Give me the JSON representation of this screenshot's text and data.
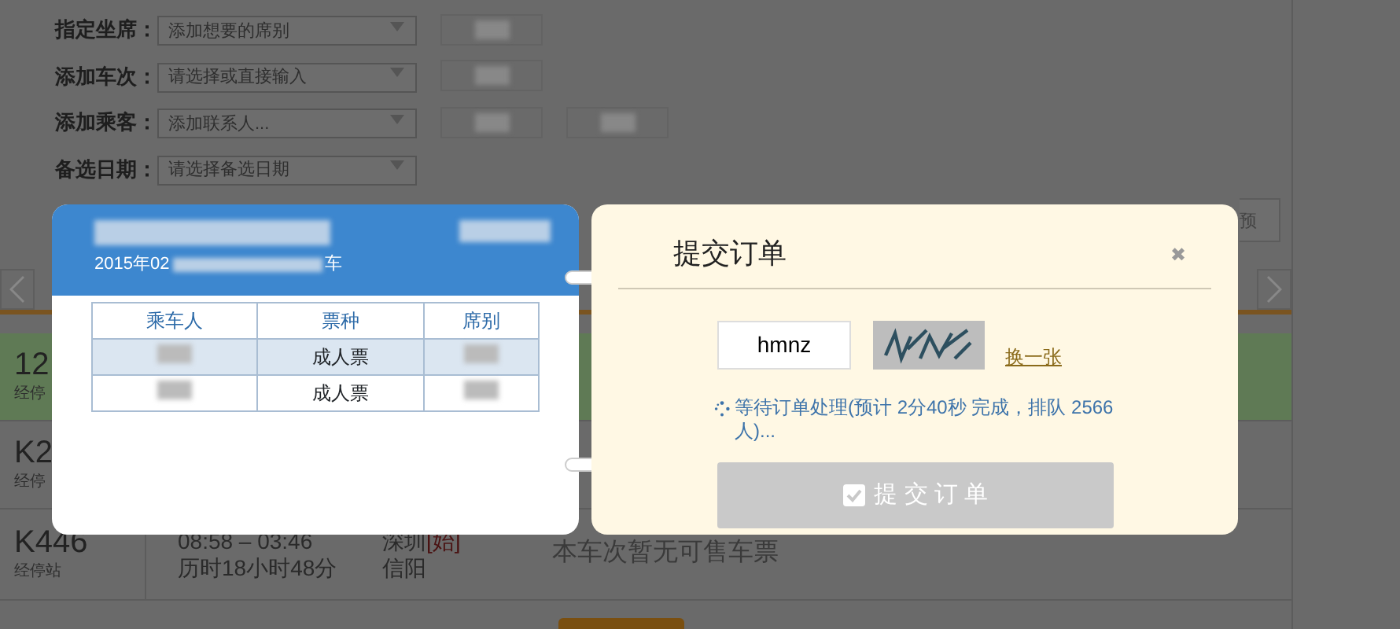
{
  "form": {
    "fields": [
      {
        "label": "指定坐席：",
        "placeholder": "添加想要的席别"
      },
      {
        "label": "添加车次：",
        "placeholder": "请选择或直接输入"
      },
      {
        "label": "添加乘客：",
        "placeholder": "添加联系人..."
      },
      {
        "label": "备选日期：",
        "placeholder": "请选择备选日期"
      }
    ]
  },
  "side_button": "预",
  "trains": [
    {
      "number": "12",
      "stops": "经停",
      "highlighted": true
    },
    {
      "number": "K2",
      "stops": "经停",
      "highlighted": false
    },
    {
      "number": "K446",
      "stops": "经停站",
      "times": "08:58 – 03:46",
      "duration": "历时18小时48分",
      "from": "深圳",
      "from_tag": "[始]",
      "to": "信阳",
      "status": "本车次暂无可售车票",
      "highlighted": false
    }
  ],
  "ticket_panel": {
    "date_prefix": "2015年02",
    "date_suffix": "车",
    "columns": [
      "乘车人",
      "票种",
      "席别"
    ],
    "rows": [
      {
        "ticket_type": "成人票",
        "selected": true
      },
      {
        "ticket_type": "成人票",
        "selected": false
      }
    ]
  },
  "submit_dialog": {
    "title": "提交订单",
    "close": "✖",
    "captcha_value": "hmnz",
    "refresh_link": "换一张",
    "status": "等待订单处理(预计 2分40秒 完成，排队 2566 人)...",
    "button": {
      "label": "提 交 订 单",
      "disabled": true
    }
  }
}
